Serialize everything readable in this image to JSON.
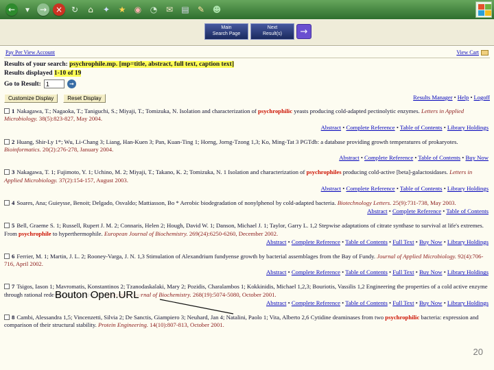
{
  "brand": {
    "toolbar_green": "#2e6e2e",
    "link_blue": "#0000bb",
    "highlight_yellow": "#ffff55",
    "term_red": "#cc1100",
    "journal_maroon": "#8b1a1a",
    "windows_flag": [
      "#e4512c",
      "#6cb33f",
      "#2a9fd8",
      "#f5bd1f"
    ]
  },
  "browser": {
    "icons": [
      {
        "name": "back-icon",
        "glyph": "←",
        "fg": "#ffffff",
        "bg": "#2d8a2d",
        "round": true
      },
      {
        "name": "back-dropdown-icon",
        "glyph": "▾",
        "fg": "#e8f5e8",
        "bg": "",
        "round": false
      },
      {
        "name": "forward-icon",
        "glyph": "→",
        "fg": "#ffffff",
        "bg": "#8fbf8f",
        "round": true
      },
      {
        "name": "stop-icon",
        "glyph": "×",
        "fg": "#ffffff",
        "bg": "#cc3322",
        "round": true
      },
      {
        "name": "refresh-icon",
        "glyph": "↻",
        "fg": "#dff0df",
        "bg": "",
        "round": false
      },
      {
        "name": "home-icon",
        "glyph": "⌂",
        "fg": "#f5f5dc",
        "bg": "",
        "round": false
      },
      {
        "name": "search-icon",
        "glyph": "✦",
        "fg": "#cfe0ff",
        "bg": "",
        "round": false
      },
      {
        "name": "favorites-icon",
        "glyph": "★",
        "fg": "#ffd24d",
        "bg": "",
        "round": false
      },
      {
        "name": "media-icon",
        "glyph": "◉",
        "fg": "#ffb0b0",
        "bg": "",
        "round": false
      },
      {
        "name": "history-icon",
        "glyph": "◔",
        "fg": "#cfe8cf",
        "bg": "",
        "round": false
      },
      {
        "name": "mail-icon",
        "glyph": "✉",
        "fg": "#f0e6c8",
        "bg": "",
        "round": false
      },
      {
        "name": "print-icon",
        "glyph": "▤",
        "fg": "#dcdcf0",
        "bg": "",
        "round": false
      },
      {
        "name": "edit-icon",
        "glyph": "✎",
        "fg": "#ffe0a0",
        "bg": "",
        "round": false
      },
      {
        "name": "messenger-icon",
        "glyph": "☻",
        "fg": "#aee4ae",
        "bg": "",
        "round": false
      }
    ]
  },
  "nav": {
    "main_button_line1": "Main",
    "main_button_line2": "Search Page",
    "next_button_line1": "Next",
    "next_button_line2": "Result(s)",
    "arrow_glyph": "→"
  },
  "header": {
    "ppv_link": "Pay Per View Account",
    "view_cart_label": "View Cart",
    "search_label": "Results of your search: ",
    "search_term": "psychrophile.mp.",
    "search_fields": " [mp=title, abstract, full text, caption text]",
    "results_displayed_label": "Results displayed ",
    "results_displayed_range": "1-10 of 19",
    "goto_label": "Go to Result:",
    "goto_value": "1",
    "go_glyph": "→",
    "customize_button": "Customize Display",
    "reset_button": "Reset Display",
    "manager_links": [
      "Results Manager",
      "Help",
      "Logoff"
    ]
  },
  "results": [
    {
      "num": "1",
      "pre": "Nakagawa, T.; Nagaoka, T.; Taniguchi, S.; Miyaji, T.; Tomizuka, N. Isolation and characterization of ",
      "term": "psychrophilic",
      "post": " yeasts producing cold-adapted pectinolytic enzymes. ",
      "journal": "Letters in Applied Microbiology.",
      "tail": " 38(5):823-827, May 2004.",
      "links": [
        "Abstract",
        "Complete Reference",
        "Table of Contents",
        "Library Holdings"
      ]
    },
    {
      "num": "2",
      "pre": "Huang, Shir-Ly 1*; Wu, Li-Chang 3; Liang, Han-Kuen 3; Pan, Kuan-Ting 1; Horng, Jorng-Tzong 1,3; Ko, Ming-Tat 3 PGTdb: a database providing growth temperatures of prokaryotes. ",
      "term": "",
      "post": "",
      "journal": "Bioinformatics.",
      "tail": " 20(2):276-278, January 2004.",
      "links": [
        "Abstract",
        "Complete Reference",
        "Table of Contents",
        "Buy Now"
      ]
    },
    {
      "num": "3",
      "pre": "Nakagawa, T. 1; Fujimoto, Y. 1; Uchino, M. 2; Miyaji, T.; Takano, K. 2; Tomizuka, N. 1 Isolation and characterization of ",
      "term": "psychrophiles",
      "post": " producing cold-active [beta]-galactosidases. ",
      "journal": "Letters in Applied Microbiology.",
      "tail": " 37(2):154-157, August 2003.",
      "links": [
        "Abstract",
        "Complete Reference",
        "Table of Contents",
        "Library Holdings"
      ]
    },
    {
      "num": "4",
      "pre": "Soares, Ana; Guieysse, Benoit; Delgado, Osvaldo; Mattiasson, Bo * Aerobic biodegradation of nonylphenol by cold-adapted bacteria. ",
      "term": "",
      "post": "",
      "journal": "Biotechnology Letters.",
      "tail": " 25(9):731-738, May 2003.",
      "links": [
        "Abstract",
        "Complete Reference",
        "Table of Contents"
      ]
    },
    {
      "num": "5",
      "pre": "Bell, Graeme S. 1; Russell, Rupert J. M. 2; Connaris, Helen 2; Hough, David W. 1; Danson, Michael J. 1; Taylor, Garry L. 1,2 Stepwise adaptations of citrate synthase to survival at life's extremes. From ",
      "term": "psychrophile",
      "post": " to hyperthermophile. ",
      "journal": "European Journal of Biochemistry.",
      "tail": " 269(24):6250-6260, December 2002.",
      "links": [
        "Abstract",
        "Complete Reference",
        "Table of Contents",
        "Full Text",
        "Buy Now",
        "Library Holdings"
      ]
    },
    {
      "num": "6",
      "pre": "Ferrier, M. 1; Martin, J. L. 2; Rooney-Varga, J. N. 1,3 Stimulation of Alexandrium fundyense growth by bacterial assemblages from the Bay of Fundy. ",
      "term": "",
      "post": "",
      "journal": "Journal of Applied Microbiology.",
      "tail": " 92(4):706-716, April 2002.",
      "links": [
        "Abstract",
        "Complete Reference",
        "Table of Contents",
        "Full Text",
        "Buy Now",
        "Library Holdings"
      ]
    },
    {
      "num": "7",
      "pre": "Tsigos, Iason 1; Mavromatis, Konstantinos 2; Tzanodaskalaki, Mary 2; Pozidis, Charalambos 1; Kokkinidis, Michael 1,2,3; Bouriotis, Vassilis 1,2 Engineering the properties of a cold active enzyme through rational redesign of the active site. ",
      "term": "",
      "post": "",
      "journal": "European Journal of Biochemistry.",
      "tail": " 268(19):5074-5080, October 2001.",
      "links": [
        "Abstract",
        "Complete Reference",
        "Table of Contents",
        "Full Text",
        "Buy Now",
        "Library Holdings"
      ]
    },
    {
      "num": "8",
      "pre": "Cambi, Alessandra 1,5; Vincenzetti, Silvia 2; De Sanctis, Giampiero 3; Neuhard, Jan 4; Natalini, Paolo 1; Vita, Alberto 2,6 Cytidine deaminases from two ",
      "term": "psychrophilic",
      "post": " bacteria: expression and comparison of their structural stability. ",
      "journal": "Protein Engineering.",
      "tail": " 14(10):807-813, October 2001.",
      "links": []
    }
  ],
  "annotation": {
    "label": "Bouton Open.URL"
  },
  "slide": {
    "page_number": "20"
  }
}
